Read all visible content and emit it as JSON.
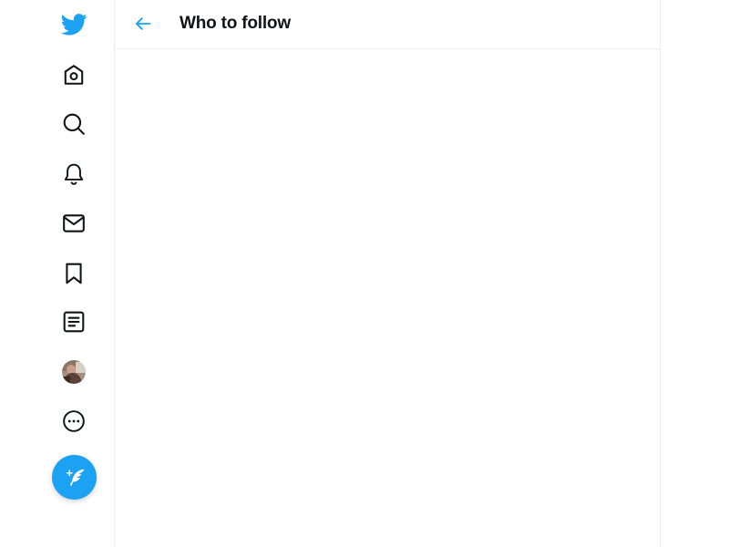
{
  "header": {
    "title": "Who to follow"
  },
  "sidebar": {
    "items": [
      {
        "icon": "twitter-logo-icon"
      },
      {
        "icon": "home-icon"
      },
      {
        "icon": "explore-search-icon"
      },
      {
        "icon": "notifications-bell-icon"
      },
      {
        "icon": "messages-envelope-icon"
      },
      {
        "icon": "bookmarks-icon"
      },
      {
        "icon": "lists-icon"
      },
      {
        "icon": "profile-avatar"
      },
      {
        "icon": "more-icon"
      }
    ],
    "compose": {
      "icon": "compose-tweet-icon"
    }
  },
  "colors": {
    "accent": "#1da1f2",
    "icon": "#0f1419",
    "border": "#ebeef0"
  }
}
